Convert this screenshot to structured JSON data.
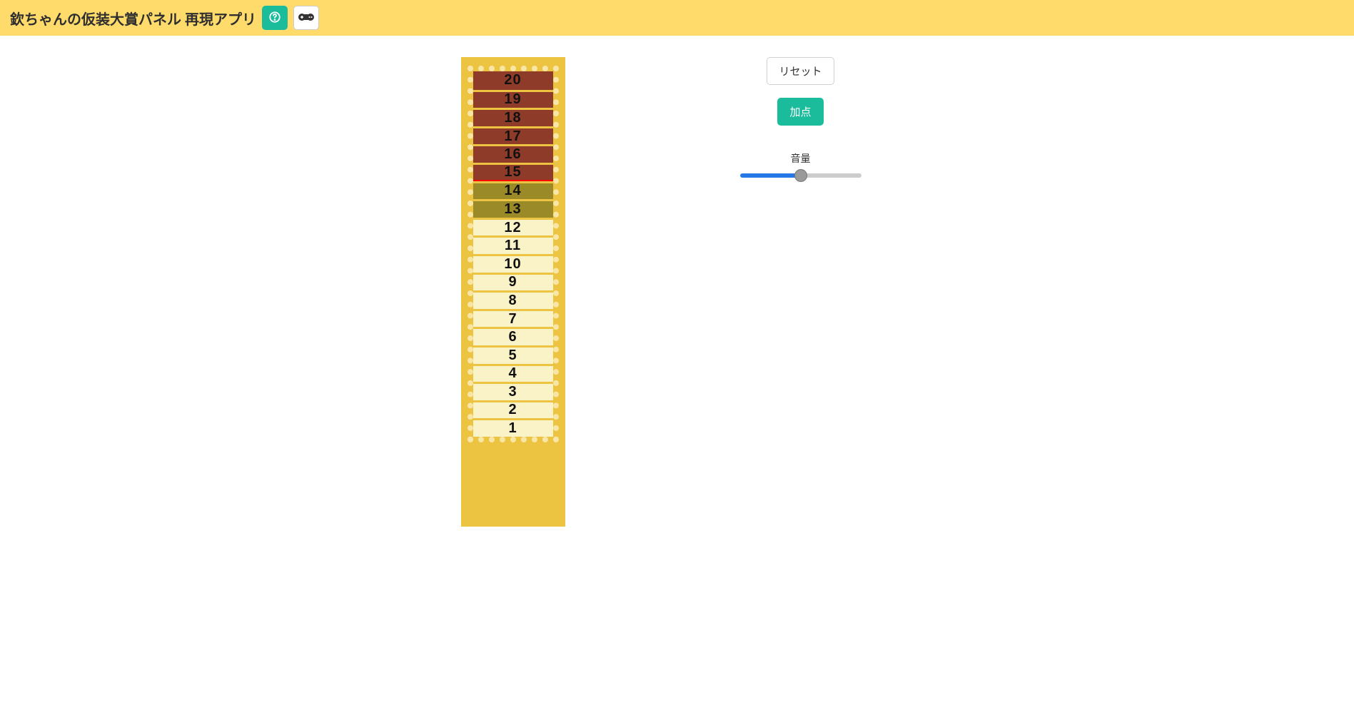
{
  "header": {
    "title": "欽ちゃんの仮装大賞パネル 再現アプリ"
  },
  "panel": {
    "pass_threshold": 15,
    "rows": [
      {
        "n": 20,
        "state": "red"
      },
      {
        "n": 19,
        "state": "red"
      },
      {
        "n": 18,
        "state": "red"
      },
      {
        "n": 17,
        "state": "red"
      },
      {
        "n": 16,
        "state": "red"
      },
      {
        "n": 15,
        "state": "red"
      },
      {
        "n": 14,
        "state": "olive"
      },
      {
        "n": 13,
        "state": "olive"
      },
      {
        "n": 12,
        "state": "off"
      },
      {
        "n": 11,
        "state": "off"
      },
      {
        "n": 10,
        "state": "off"
      },
      {
        "n": 9,
        "state": "off"
      },
      {
        "n": 8,
        "state": "off"
      },
      {
        "n": 7,
        "state": "off"
      },
      {
        "n": 6,
        "state": "off"
      },
      {
        "n": 5,
        "state": "off"
      },
      {
        "n": 4,
        "state": "off"
      },
      {
        "n": 3,
        "state": "off"
      },
      {
        "n": 2,
        "state": "off"
      },
      {
        "n": 1,
        "state": "off"
      }
    ]
  },
  "controls": {
    "reset_label": "リセット",
    "add_label": "加点",
    "volume_label": "音量",
    "volume_value": 50
  }
}
